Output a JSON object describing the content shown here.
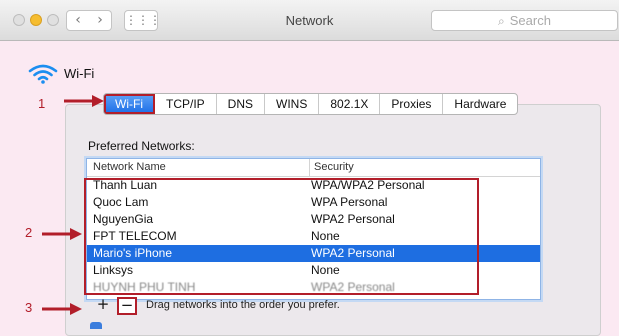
{
  "window": {
    "title": "Network",
    "search_placeholder": "Search",
    "nav_back": "‹",
    "nav_forward": "›",
    "grid_icon": "⋮⋮⋮"
  },
  "wifi_header": {
    "label": "Wi-Fi"
  },
  "tabs": [
    {
      "label": "Wi-Fi",
      "active": true
    },
    {
      "label": "TCP/IP",
      "active": false
    },
    {
      "label": "DNS",
      "active": false
    },
    {
      "label": "WINS",
      "active": false
    },
    {
      "label": "802.1X",
      "active": false
    },
    {
      "label": "Proxies",
      "active": false
    },
    {
      "label": "Hardware",
      "active": false
    }
  ],
  "preferred": {
    "label": "Preferred Networks:",
    "columns": [
      "Network Name",
      "Security"
    ],
    "rows": [
      {
        "name": "Thanh Luan",
        "security": "WPA/WPA2 Personal"
      },
      {
        "name": "Quoc Lam",
        "security": "WPA Personal"
      },
      {
        "name": "NguyenGia",
        "security": "WPA2 Personal"
      },
      {
        "name": "FPT TELECOM",
        "security": "None"
      },
      {
        "name": "Mario's iPhone",
        "security": "WPA2 Personal",
        "selected": true
      },
      {
        "name": "Linksys",
        "security": "None"
      },
      {
        "name": "HUYNH PHU TINH",
        "security": "WPA2 Personal",
        "cutoff": true
      }
    ]
  },
  "controls": {
    "add": "+",
    "remove": "−",
    "drag_hint": "Drag networks into the order you prefer."
  },
  "annotations": [
    {
      "label": "1"
    },
    {
      "label": "2"
    },
    {
      "label": "3"
    }
  ],
  "colors": {
    "accent": "#1e6ee1",
    "annotation": "#b21e2a",
    "background": "#fbe9f2"
  }
}
